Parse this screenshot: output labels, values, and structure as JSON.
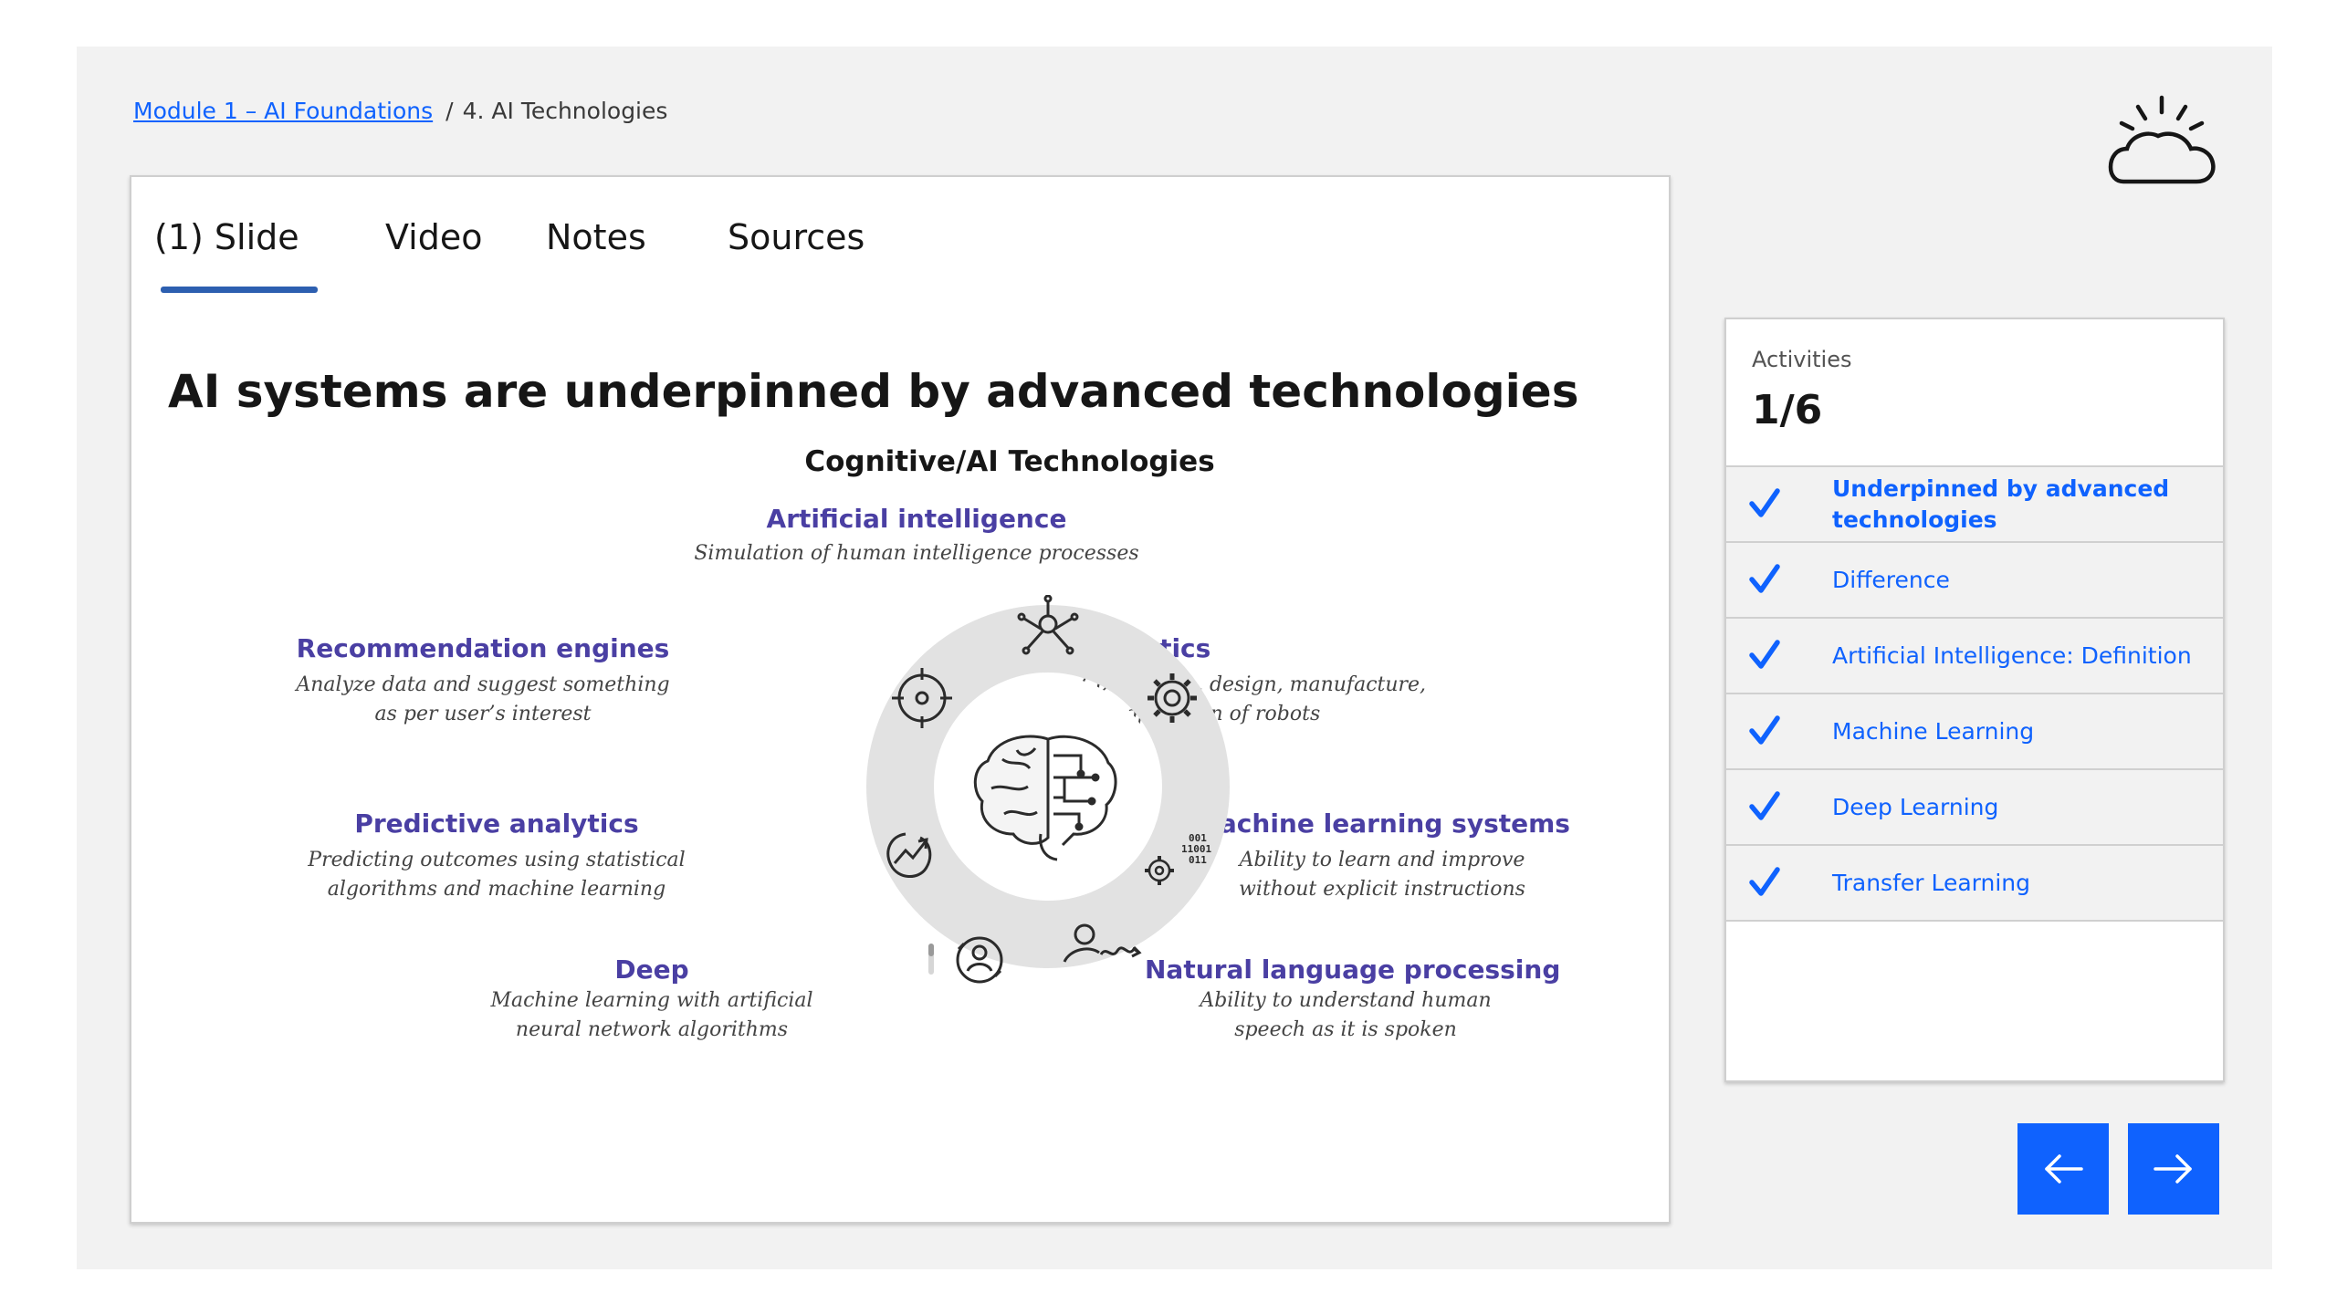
{
  "breadcrumb": {
    "parent_link": "Module 1 – AI Foundations",
    "separator": "/",
    "current": "4. AI Technologies"
  },
  "tabs": [
    {
      "label": "(1) Slide",
      "active": true
    },
    {
      "label": "Video"
    },
    {
      "label": "Notes"
    },
    {
      "label": "Sources"
    }
  ],
  "slide": {
    "title": "AI systems are underpinned by advanced technologies",
    "subtitle": "Cognitive/AI Technologies",
    "technologies": {
      "ai": {
        "title": "Artificial intelligence",
        "desc": "Simulation of human intelligence processes"
      },
      "recommendation": {
        "title": "Recommendation engines",
        "desc1": "Analyze data and suggest something",
        "desc2": "as per user’s interest"
      },
      "robotics": {
        "title": "Robotics",
        "desc1": "Conception, design, manufacture,",
        "desc2": "and operation of robots"
      },
      "predictive": {
        "title": "Predictive analytics",
        "desc1": "Predicting outcomes using statistical",
        "desc2": "algorithms and machine learning"
      },
      "ml": {
        "title": "Machine learning systems",
        "desc1": "Ability to learn and improve",
        "desc2": "without explicit instructions"
      },
      "deep": {
        "title": "Deep",
        "desc1": "Machine learning with artificial",
        "desc2": "neural network algorithms"
      },
      "nlp": {
        "title": "Natural language processing",
        "desc1": "Ability to understand human",
        "desc2": "speech as it is spoken"
      }
    },
    "icons": [
      "network-hub-icon",
      "gear-icon",
      "crosshair-icon",
      "brain-circuit-icon",
      "chart-arrow-icon",
      "binary-gear-icon",
      "user-sync-icon",
      "speaking-person-icon"
    ],
    "binary_text": "001\n11001\n011"
  },
  "activities": {
    "label": "Activities",
    "count": "1/6",
    "items": [
      {
        "label": "Underpinned by advanced technologies",
        "done": true,
        "current": true
      },
      {
        "label": "Difference",
        "done": true
      },
      {
        "label": "Artificial Intelligence: Definition",
        "done": true
      },
      {
        "label": "Machine Learning",
        "done": true
      },
      {
        "label": "Deep Learning",
        "done": true
      },
      {
        "label": "Transfer Learning",
        "done": true
      }
    ]
  },
  "navigation": {
    "prev": "arrow-left-icon",
    "next": "arrow-right-icon"
  },
  "colors": {
    "accent_blue": "#0f62fe",
    "tab_underline": "#2d5fb0",
    "tech_title": "#4a3fa3",
    "stage_bg": "#f2f2f2",
    "ring_gray": "#e0e0e0"
  }
}
